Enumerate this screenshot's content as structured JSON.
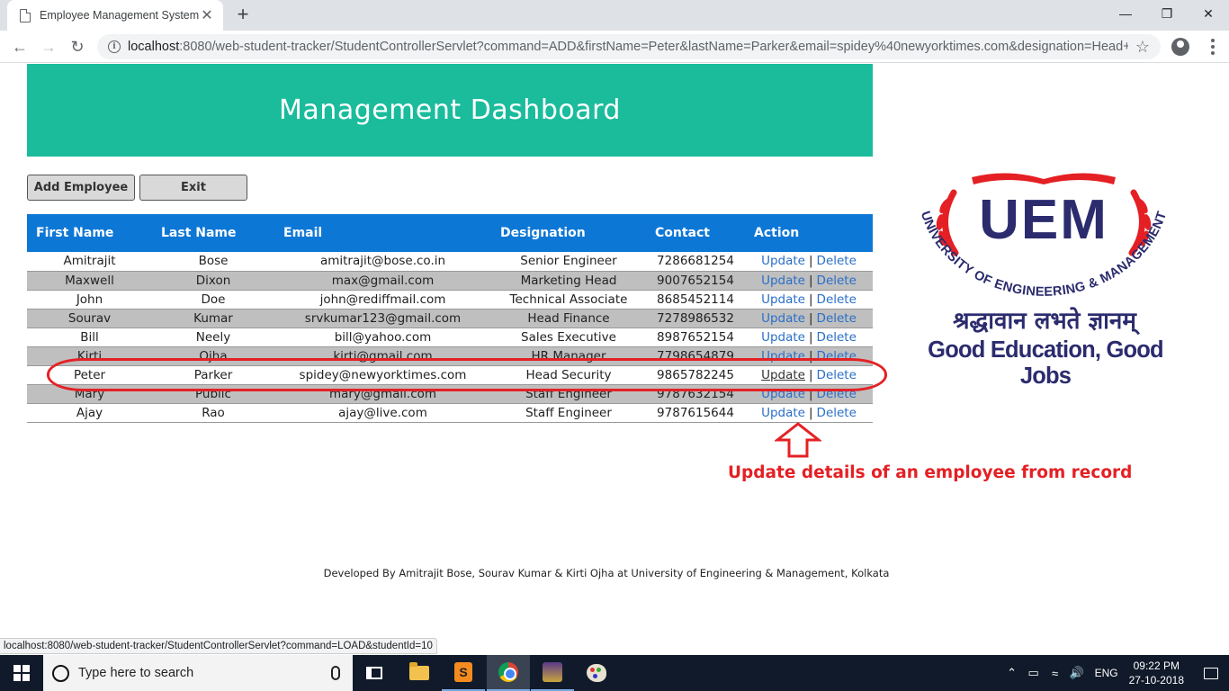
{
  "browser": {
    "tab_title": "Employee Management System",
    "tab_close": "✕",
    "new_tab": "+",
    "url_host": "localhost",
    "url_rest": ":8080/web-student-tracker/StudentControllerServlet?command=ADD&firstName=Peter&lastName=Parker&email=spidey%40newyorktimes.com&designation=Head+S...",
    "status_url": "localhost:8080/web-student-tracker/StudentControllerServlet?command=LOAD&studentId=10"
  },
  "page": {
    "title": "Management Dashboard",
    "add_button": "Add Employee",
    "exit_button": "Exit",
    "footer": "Developed By Amitrajit Bose, Sourav Kumar & Kirti Ojha at University of Engineering & Management, Kolkata",
    "annotation": "Update details of an employee from record",
    "accent_color": "#1abc9c",
    "header_color": "#0d77d6",
    "annotation_color": "#e42024"
  },
  "table": {
    "headers": [
      "First Name",
      "Last Name",
      "Email",
      "Designation",
      "Contact",
      "Action"
    ],
    "rows": [
      {
        "first": "Amitrajit",
        "last": "Bose",
        "email": "amitrajit@bose.co.in",
        "designation": "Senior Engineer",
        "contact": "7286681254",
        "update": "Update",
        "delete": "Delete"
      },
      {
        "first": "Maxwell",
        "last": "Dixon",
        "email": "max@gmail.com",
        "designation": "Marketing Head",
        "contact": "9007652154",
        "update": "Update",
        "delete": "Delete"
      },
      {
        "first": "John",
        "last": "Doe",
        "email": "john@rediffmail.com",
        "designation": "Technical Associate",
        "contact": "8685452114",
        "update": "Update",
        "delete": "Delete"
      },
      {
        "first": "Sourav",
        "last": "Kumar",
        "email": "srvkumar123@gmail.com",
        "designation": "Head Finance",
        "contact": "7278986532",
        "update": "Update",
        "delete": "Delete"
      },
      {
        "first": "Bill",
        "last": "Neely",
        "email": "bill@yahoo.com",
        "designation": "Sales Executive",
        "contact": "8987652154",
        "update": "Update",
        "delete": "Delete"
      },
      {
        "first": "Kirti",
        "last": "Ojha",
        "email": "kirti@gmail.com",
        "designation": "HR Manager",
        "contact": "7798654879",
        "update": "Update",
        "delete": "Delete"
      },
      {
        "first": "Peter",
        "last": "Parker",
        "email": "spidey@newyorktimes.com",
        "designation": "Head Security",
        "contact": "9865782245",
        "update": "Update",
        "delete": "Delete"
      },
      {
        "first": "Mary",
        "last": "Public",
        "email": "mary@gmail.com",
        "designation": "Staff Engineer",
        "contact": "9787632154",
        "update": "Update",
        "delete": "Delete"
      },
      {
        "first": "Ajay",
        "last": "Rao",
        "email": "ajay@live.com",
        "designation": "Staff Engineer",
        "contact": "9787615644",
        "update": "Update",
        "delete": "Delete"
      }
    ],
    "action_separator": "|"
  },
  "logo": {
    "initials": "UEM",
    "arc_text": "UNIVERSITY OF ENGINEERING & MANAGEMENT",
    "hindi_text": "श्रद्धावान लभते ज्ञानम्",
    "motto": "Good Education, Good Jobs"
  },
  "taskbar": {
    "search_placeholder": "Type here to search",
    "language": "ENG",
    "time": "09:22 PM",
    "date": "27-10-2018"
  }
}
